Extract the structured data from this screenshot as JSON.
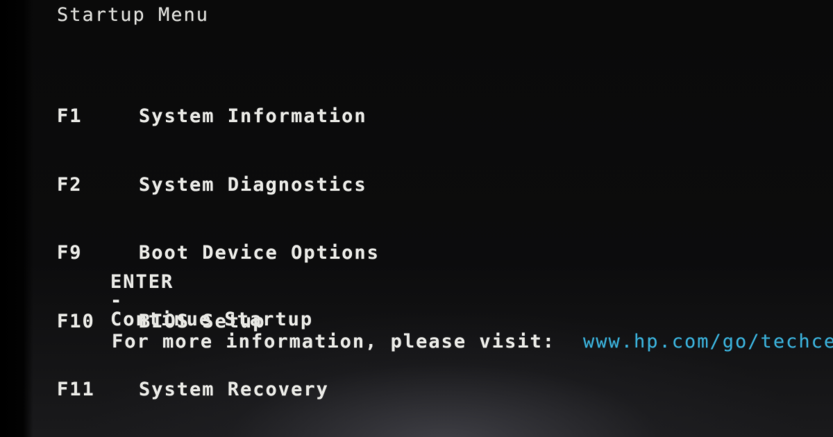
{
  "title": "Startup Menu",
  "menu_items": [
    {
      "key": "F1",
      "label": "System Information"
    },
    {
      "key": "F2",
      "label": "System Diagnostics"
    },
    {
      "key": "F9",
      "label": "Boot Device Options"
    },
    {
      "key": "F10",
      "label": "BIOS Setup"
    },
    {
      "key": "F11",
      "label": "System Recovery"
    }
  ],
  "enter": {
    "key": "ENTER",
    "separator": "-",
    "label": "Continue Startup"
  },
  "info": {
    "text": "For more information, please visit:",
    "url": "www.hp.com/go/techcenter"
  },
  "colors": {
    "text": "#e6e6e2",
    "link": "#39a9d0",
    "background": "#0a0a0a"
  }
}
